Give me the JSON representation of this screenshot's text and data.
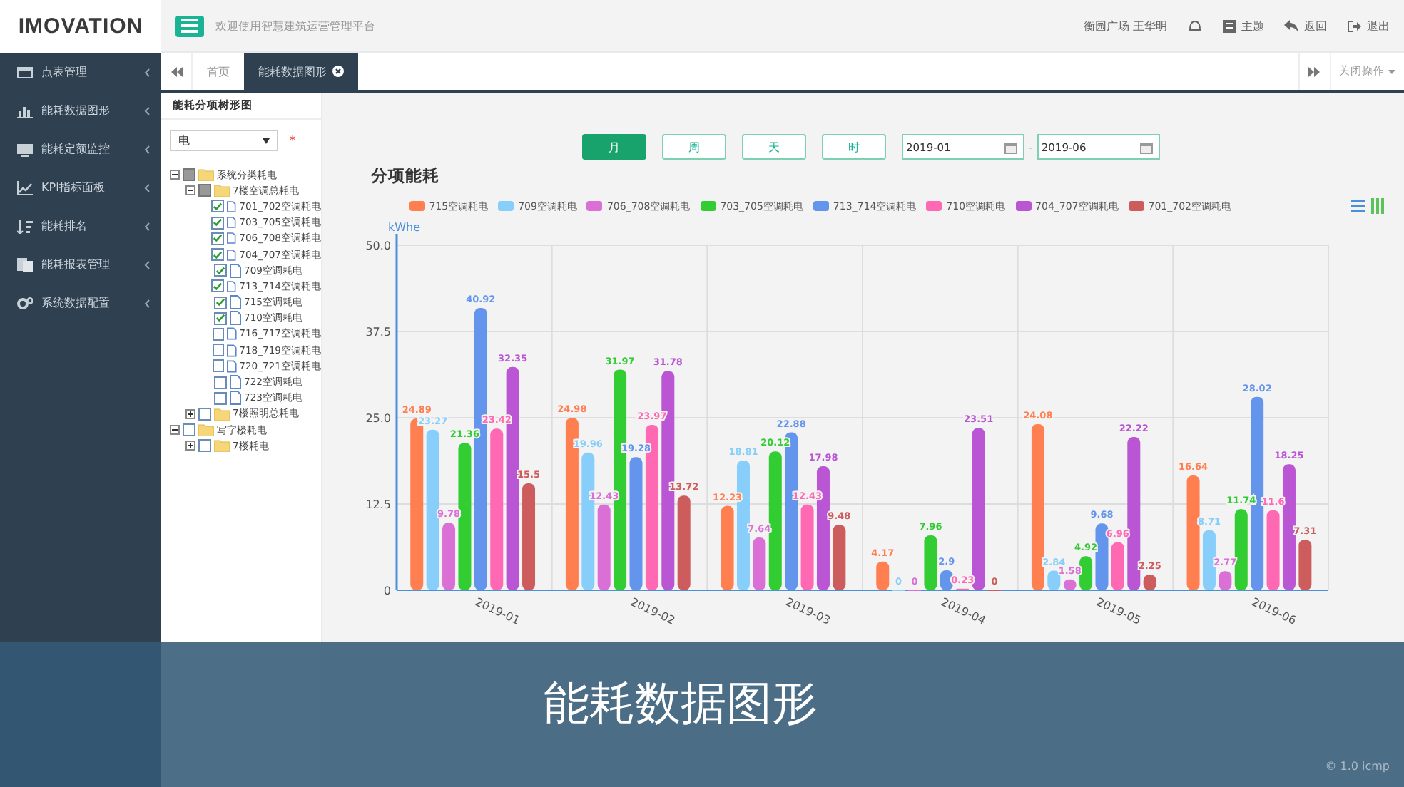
{
  "header": {
    "logo": "IMOVATION",
    "welcome": "欢迎使用智慧建筑运营管理平台",
    "user": "衡园广场 王华明",
    "actions": [
      {
        "kind": "theme",
        "label": "主题"
      },
      {
        "kind": "back",
        "label": "返回"
      },
      {
        "kind": "logout",
        "label": "退出"
      }
    ]
  },
  "sidebar": {
    "items": [
      {
        "kind": "table",
        "label": "点表管理"
      },
      {
        "kind": "bars",
        "label": "能耗数据图形"
      },
      {
        "kind": "monitor",
        "label": "能耗定额监控"
      },
      {
        "kind": "line",
        "label": "KPI指标面板"
      },
      {
        "kind": "rank",
        "label": "能耗排名"
      },
      {
        "kind": "report",
        "label": "能耗报表管理"
      },
      {
        "kind": "gears",
        "label": "系统数据配置"
      }
    ]
  },
  "tabs": [
    {
      "label": "首页",
      "selected": false,
      "closable": false
    },
    {
      "label": "能耗数据图形",
      "selected": true,
      "closable": true
    }
  ],
  "close_menu": "关闭操作",
  "tree_panel": {
    "title": "能耗分项树形图",
    "select_value": "电",
    "required_mark": "*",
    "nodes": [
      {
        "label": "系统分类耗电",
        "kind": "folder",
        "checked": false,
        "partial": true,
        "expanded": true,
        "children": [
          {
            "label": "7楼空调总耗电",
            "kind": "folder",
            "checked": false,
            "partial": true,
            "expanded": true,
            "children": [
              {
                "label": "701_702空调耗电",
                "kind": "file",
                "checked": true
              },
              {
                "label": "703_705空调耗电",
                "kind": "file",
                "checked": true
              },
              {
                "label": "706_708空调耗电",
                "kind": "file",
                "checked": true
              },
              {
                "label": "704_707空调耗电",
                "kind": "file",
                "checked": true
              },
              {
                "label": "709空调耗电",
                "kind": "file",
                "checked": true
              },
              {
                "label": "713_714空调耗电",
                "kind": "file",
                "checked": true
              },
              {
                "label": "715空调耗电",
                "kind": "file",
                "checked": true
              },
              {
                "label": "710空调耗电",
                "kind": "file",
                "checked": true
              },
              {
                "label": "716_717空调耗电",
                "kind": "file",
                "checked": false
              },
              {
                "label": "718_719空调耗电",
                "kind": "file",
                "checked": false
              },
              {
                "label": "720_721空调耗电",
                "kind": "file",
                "checked": false
              },
              {
                "label": "722空调耗电",
                "kind": "file",
                "checked": false
              },
              {
                "label": "723空调耗电",
                "kind": "file",
                "checked": false
              }
            ]
          },
          {
            "label": "7楼照明总耗电",
            "kind": "folder",
            "checked": false,
            "partial": false,
            "expanded": false
          }
        ]
      },
      {
        "label": "写字楼耗电",
        "kind": "folder",
        "checked": false,
        "partial": false,
        "expanded": true,
        "children": [
          {
            "label": "7楼耗电",
            "kind": "folder",
            "checked": false,
            "partial": false,
            "expanded": false
          }
        ]
      }
    ]
  },
  "period_buttons": [
    {
      "label": "月",
      "selected": true
    },
    {
      "label": "周",
      "selected": false
    },
    {
      "label": "天",
      "selected": false
    },
    {
      "label": "时",
      "selected": false
    }
  ],
  "date_from": "2019-01",
  "date_separator": "-",
  "date_to": "2019-06",
  "chart_title": "分项能耗",
  "chart_data": {
    "type": "bar",
    "ylabel": "kWhe",
    "categories": [
      "2019-01",
      "2019-02",
      "2019-03",
      "2019-04",
      "2019-05",
      "2019-06"
    ],
    "ylim": [
      0,
      50
    ],
    "grid": true,
    "yticks": [
      {
        "value": 0,
        "label": "0"
      },
      {
        "value": 12.5,
        "label": "12.5"
      },
      {
        "value": 25,
        "label": "25.0"
      },
      {
        "value": 37.5,
        "label": "37.5"
      },
      {
        "value": 50,
        "label": "50.0"
      }
    ],
    "data_labels": true,
    "series": [
      {
        "name": "715空调耗电",
        "color": "#ff7f50",
        "values": [
          24.89,
          24.98,
          12.23,
          4.17,
          24.08,
          16.64
        ]
      },
      {
        "name": "709空调耗电",
        "color": "#87cefa",
        "values": [
          23.27,
          19.96,
          18.81,
          0,
          2.84,
          8.71
        ]
      },
      {
        "name": "706_708空调耗电",
        "color": "#da70d6",
        "values": [
          9.78,
          12.43,
          7.64,
          0,
          1.58,
          2.77
        ]
      },
      {
        "name": "703_705空调耗电",
        "color": "#32cd32",
        "values": [
          21.36,
          31.97,
          20.12,
          7.96,
          4.92,
          11.74
        ]
      },
      {
        "name": "713_714空调耗电",
        "color": "#6495ed",
        "values": [
          40.92,
          19.28,
          22.88,
          2.9,
          9.68,
          28.02
        ]
      },
      {
        "name": "710空调耗电",
        "color": "#ff69b4",
        "values": [
          23.42,
          23.97,
          12.43,
          0.23,
          6.96,
          11.6
        ]
      },
      {
        "name": "704_707空调耗电",
        "color": "#ba55d3",
        "values": [
          32.35,
          31.78,
          17.98,
          23.51,
          22.22,
          18.25
        ]
      },
      {
        "name": "701_702空调耗电",
        "color": "#cd5c5c",
        "values": [
          15.5,
          13.72,
          9.48,
          0,
          2.25,
          7.31
        ]
      }
    ]
  },
  "banner": "能耗数据图形",
  "footer": "© 1.0 icmp"
}
